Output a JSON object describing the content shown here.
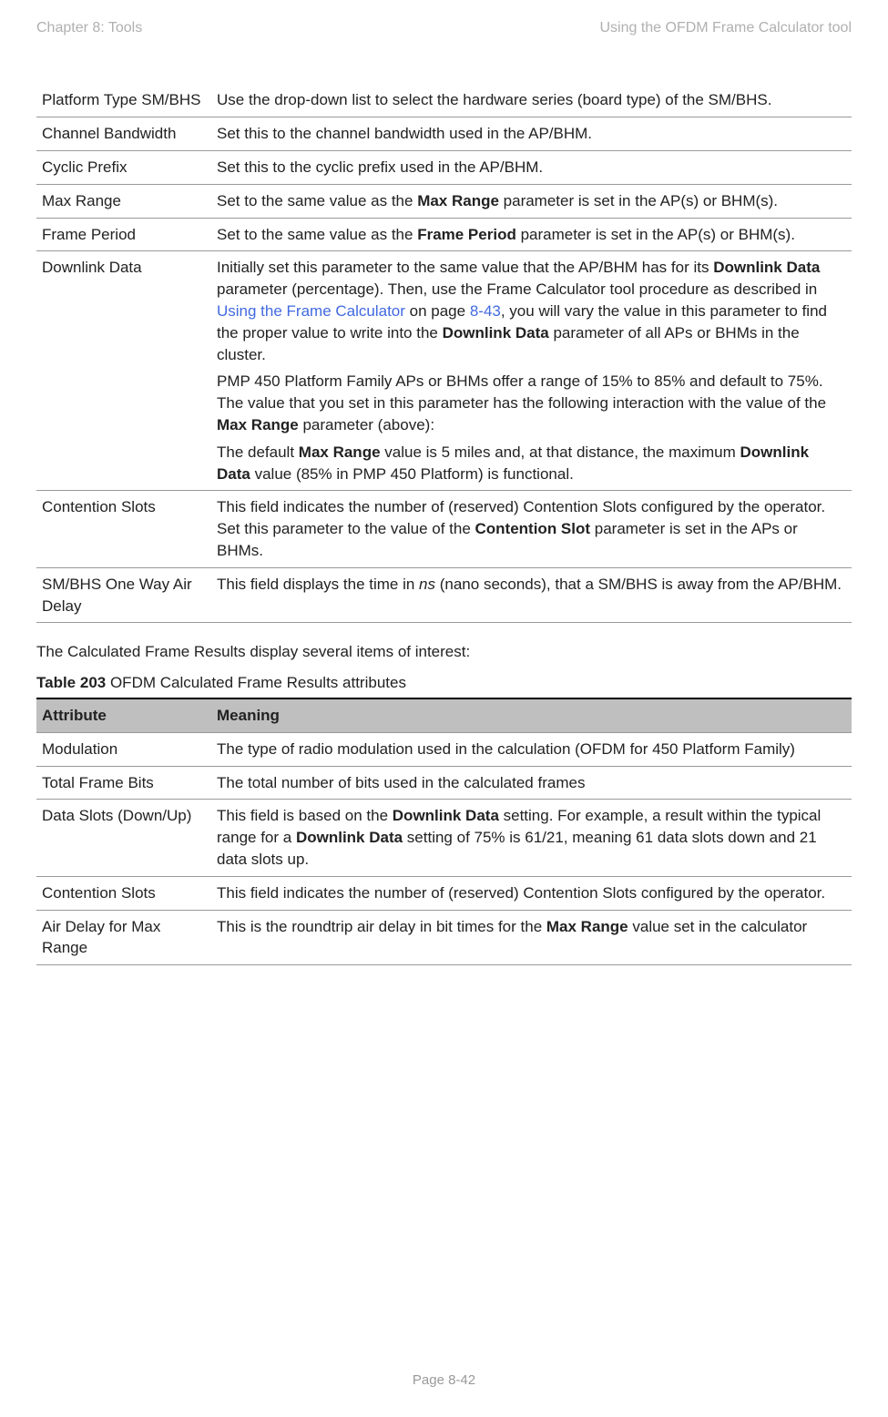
{
  "header": {
    "left": "Chapter 8:  Tools",
    "right": "Using the OFDM Frame Calculator tool"
  },
  "table1": {
    "rows": [
      {
        "attr": "Platform Type SM/BHS",
        "meaning_parts": [
          {
            "t": "Use the drop-down list to select the hardware series (board type) of the SM/BHS."
          }
        ]
      },
      {
        "attr": "Channel Bandwidth",
        "meaning_parts": [
          {
            "t": "Set this to the channel bandwidth used in the AP/BHM."
          }
        ]
      },
      {
        "attr": "Cyclic Prefix",
        "meaning_parts": [
          {
            "t": "Set this to the cyclic prefix used in the AP/BHM."
          }
        ]
      },
      {
        "attr": "Max Range",
        "meaning_parts": [
          {
            "t": "Set to the same value as the "
          },
          {
            "t": "Max Range",
            "b": true
          },
          {
            "t": " parameter is set in the AP(s) or BHM(s)."
          }
        ]
      },
      {
        "attr": "Frame Period",
        "meaning_parts": [
          {
            "t": "Set to the same value as the "
          },
          {
            "t": "Frame Period",
            "b": true
          },
          {
            "t": " parameter is set in the AP(s) or BHM(s)."
          }
        ]
      },
      {
        "attr": "Downlink Data",
        "meaning_parts": [
          {
            "t": "Initially set this parameter to the same value that the AP/BHM has for its "
          },
          {
            "t": "Downlink Data",
            "b": true
          },
          {
            "t": " parameter (percentage). Then, use the Frame Calculator tool procedure as described in "
          },
          {
            "t": "Using the Frame Calculator",
            "link": true
          },
          {
            "t": " on page "
          },
          {
            "t": "8-43",
            "link": true
          },
          {
            "t": ", you will vary the value in this parameter to find the proper value to write into the "
          },
          {
            "t": "Downlink Data",
            "b": true
          },
          {
            "t": " parameter of all APs or BHMs in the cluster."
          },
          {
            "br": true
          },
          {
            "t": "PMP 450 Platform Family APs or BHMs offer a range of 15% to 85% and default to 75%. The value that you set in this parameter has the following interaction with the value of the "
          },
          {
            "t": "Max Range",
            "b": true
          },
          {
            "t": " parameter (above):"
          },
          {
            "br": true
          },
          {
            "t": "The default "
          },
          {
            "t": "Max Range",
            "b": true
          },
          {
            "t": " value is 5 miles and, at that distance, the maximum "
          },
          {
            "t": "Downlink Data",
            "b": true
          },
          {
            "t": " value (85% in PMP 450 Platform) is functional."
          }
        ]
      },
      {
        "attr": "Contention Slots",
        "meaning_parts": [
          {
            "t": "This field indicates the number of (reserved) Contention Slots configured by the operator. Set this parameter to the value of the "
          },
          {
            "t": "Contention Slot",
            "b": true
          },
          {
            "t": " parameter is set in the APs or BHMs."
          }
        ]
      },
      {
        "attr": "SM/BHS One Way Air Delay",
        "meaning_parts": [
          {
            "t": "This field displays the time in "
          },
          {
            "t": "ns",
            "i": true
          },
          {
            "t": " (nano seconds), that a SM/BHS is away from the AP/BHM."
          }
        ]
      }
    ]
  },
  "intertext": "The Calculated Frame Results display several items of interest:",
  "caption_prefix": "Table 203",
  "caption_rest": " OFDM Calculated Frame Results attributes",
  "table2": {
    "head_attr": "Attribute",
    "head_meaning": "Meaning",
    "rows": [
      {
        "attr": "Modulation",
        "meaning_parts": [
          {
            "t": "The type of radio modulation used in the calculation (OFDM for 450 Platform Family)"
          }
        ]
      },
      {
        "attr": "Total Frame Bits",
        "meaning_parts": [
          {
            "t": "The total number of bits used in the calculated frames"
          }
        ]
      },
      {
        "attr": "Data Slots (Down/Up)",
        "meaning_parts": [
          {
            "t": "This field is based on the "
          },
          {
            "t": "Downlink Data",
            "b": true
          },
          {
            "t": " setting. For example, a result within the typical range for a "
          },
          {
            "t": "Downlink Data",
            "b": true
          },
          {
            "t": " setting of 75% is 61/21, meaning 61 data slots down and 21 data slots up."
          }
        ]
      },
      {
        "attr": "Contention Slots",
        "meaning_parts": [
          {
            "t": "This field indicates the number of (reserved) Contention Slots configured by the operator."
          }
        ]
      },
      {
        "attr": "Air Delay for Max Range",
        "meaning_parts": [
          {
            "t": "This is the roundtrip air delay in bit times for the "
          },
          {
            "t": "Max Range",
            "b": true
          },
          {
            "t": " value set in the calculator"
          }
        ]
      }
    ]
  },
  "footer": "Page 8-42"
}
